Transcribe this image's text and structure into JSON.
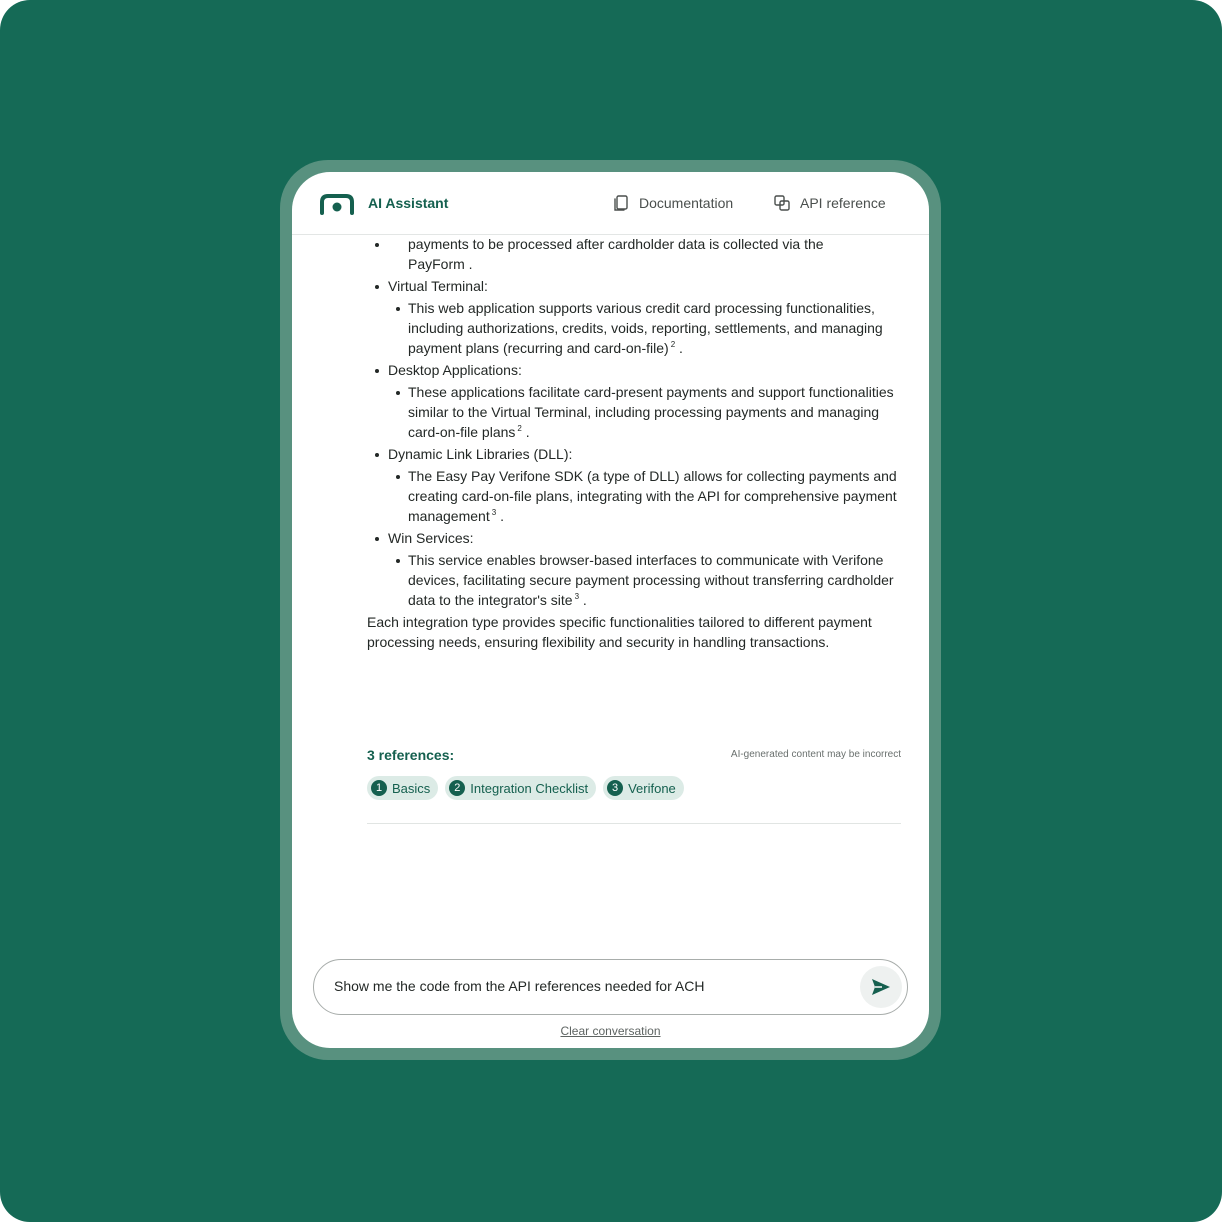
{
  "header": {
    "title": "AI Assistant",
    "nav": [
      {
        "label": "Documentation",
        "icon": "copy-icon"
      },
      {
        "label": "API reference",
        "icon": "api-reference-icon"
      }
    ]
  },
  "message": {
    "partial_line_1": "payments to be processed after cardholder data is collected via the",
    "partial_line_2": "PayForm .",
    "items": [
      {
        "title": "Virtual Terminal:",
        "detail": "This web application supports various credit card processing functionalities, including authorizations, credits, voids, reporting, settlements, and managing payment plans (recurring and card-on-file)",
        "ref": "2",
        "end": "."
      },
      {
        "title": "Desktop Applications:",
        "detail": "These applications facilitate card-present payments and support functionalities similar to the Virtual Terminal, including processing payments and managing card-on-file plans",
        "ref": "2",
        "end": "."
      },
      {
        "title": "Dynamic Link Libraries (DLL):",
        "detail": "The Easy Pay Verifone SDK (a type of DLL) allows for collecting payments and creating card-on-file plans, integrating with the API for comprehensive payment management",
        "ref": "3",
        "end": "."
      },
      {
        "title": "Win Services:",
        "detail": "This service enables browser-based interfaces to communicate with Verifone devices, facilitating secure payment processing without transferring cardholder data to the integrator's site",
        "ref": "3",
        "end": "."
      }
    ],
    "summary": "Each integration type provides specific functionalities tailored to different payment processing needs, ensuring flexibility and security in handling transactions."
  },
  "references": {
    "title": "3 references:",
    "disclaimer": "AI-generated content may be incorrect",
    "items": [
      {
        "num": "1",
        "label": "Basics"
      },
      {
        "num": "2",
        "label": "Integration Checklist"
      },
      {
        "num": "3",
        "label": "Verifone"
      }
    ]
  },
  "input": {
    "value": "Show me the code from the API references needed for ACH",
    "send_icon": "send-icon"
  },
  "clear_label": "Clear conversation",
  "colors": {
    "background": "#156a56",
    "frame": "#58917f",
    "accent": "#15604f",
    "chip": "#dcebe6"
  }
}
